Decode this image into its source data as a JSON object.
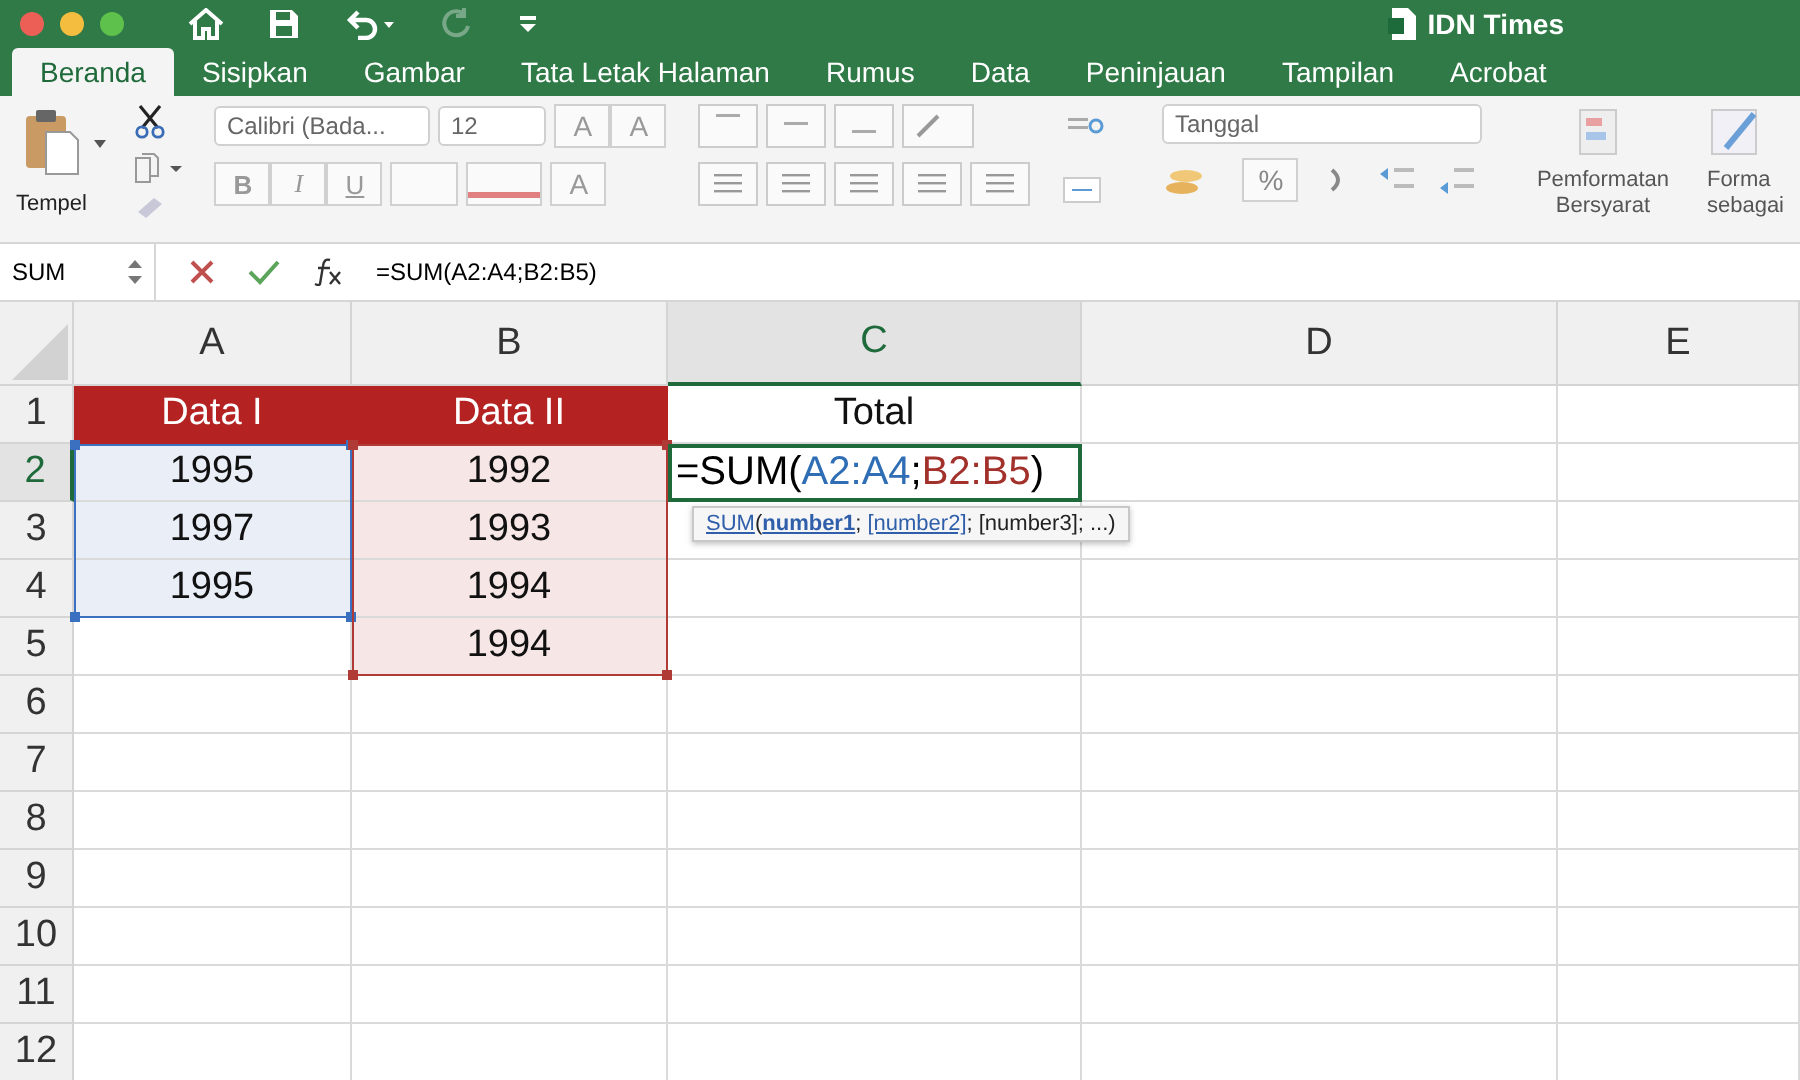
{
  "window": {
    "title": "IDN Times"
  },
  "quick_access": {
    "redo_disabled": true
  },
  "tabs": [
    {
      "label": "Beranda",
      "selected": true
    },
    {
      "label": "Sisipkan",
      "selected": false
    },
    {
      "label": "Gambar",
      "selected": false
    },
    {
      "label": "Tata Letak Halaman",
      "selected": false
    },
    {
      "label": "Rumus",
      "selected": false
    },
    {
      "label": "Data",
      "selected": false
    },
    {
      "label": "Peninjauan",
      "selected": false
    },
    {
      "label": "Tampilan",
      "selected": false
    },
    {
      "label": "Acrobat",
      "selected": false
    }
  ],
  "ribbon": {
    "paste_label": "Tempel",
    "font_name": "Calibri (Bada...",
    "font_size": "12",
    "grow_font": "A",
    "shrink_font": "A",
    "style_buttons": [
      "B",
      "I",
      "U"
    ],
    "font_color": "A",
    "number_format": "Tanggal",
    "percent": "%",
    "conditional_format": "Pemformatan Bersyarat",
    "format_table": [
      "Forma",
      "sebagai"
    ]
  },
  "formula_bar": {
    "name_box": "SUM",
    "formula": "=SUM(A2:A4;B2:B5)"
  },
  "sheet": {
    "columns": [
      {
        "label": "A",
        "selected": false
      },
      {
        "label": "B",
        "selected": false
      },
      {
        "label": "C",
        "selected": true
      },
      {
        "label": "D",
        "selected": false
      },
      {
        "label": "E",
        "selected": false
      }
    ],
    "rows": [
      {
        "label": "1",
        "selected": false,
        "cells": [
          {
            "kind": "header",
            "text": "Data I"
          },
          {
            "kind": "header",
            "text": "Data II"
          },
          {
            "kind": "plain",
            "text": "Total"
          },
          {
            "kind": "plain"
          },
          {
            "kind": "plain"
          }
        ]
      },
      {
        "label": "2",
        "selected": true,
        "cells": [
          {
            "kind": "range_a",
            "text": "1995"
          },
          {
            "kind": "range_b",
            "text": "1992"
          },
          {
            "kind": "editing"
          },
          {
            "kind": "plain"
          },
          {
            "kind": "plain"
          }
        ]
      },
      {
        "label": "3",
        "selected": false,
        "cells": [
          {
            "kind": "range_a",
            "text": "1997"
          },
          {
            "kind": "range_b",
            "text": "1993"
          },
          {
            "kind": "plain"
          },
          {
            "kind": "plain"
          },
          {
            "kind": "plain"
          }
        ]
      },
      {
        "label": "4",
        "selected": false,
        "cells": [
          {
            "kind": "range_a",
            "text": "1995"
          },
          {
            "kind": "range_b",
            "text": "1994"
          },
          {
            "kind": "plain"
          },
          {
            "kind": "plain"
          },
          {
            "kind": "plain"
          }
        ]
      },
      {
        "label": "5",
        "selected": false,
        "cells": [
          {
            "kind": "plain"
          },
          {
            "kind": "range_b",
            "text": "1994"
          },
          {
            "kind": "plain"
          },
          {
            "kind": "plain"
          },
          {
            "kind": "plain"
          }
        ]
      },
      {
        "label": "6",
        "selected": false,
        "cells": []
      },
      {
        "label": "7",
        "selected": false,
        "cells": []
      },
      {
        "label": "8",
        "selected": false,
        "cells": []
      },
      {
        "label": "9",
        "selected": false,
        "cells": []
      },
      {
        "label": "10",
        "selected": false,
        "cells": []
      },
      {
        "label": "11",
        "selected": false,
        "cells": []
      },
      {
        "label": "12",
        "selected": false,
        "cells": []
      }
    ],
    "edit_formula": [
      {
        "text": "=SUM(",
        "color": "#000000"
      },
      {
        "text": "A2:A4",
        "color": "#2f6db5"
      },
      {
        "text": ";",
        "color": "#000000"
      },
      {
        "text": "B2:B5",
        "color": "#a3312b"
      },
      {
        "text": ")",
        "color": "#000000"
      }
    ],
    "tooltip": [
      {
        "kind": "link",
        "text": "SUM"
      },
      {
        "kind": "plain",
        "text": "("
      },
      {
        "kind": "bold_link",
        "text": "number1"
      },
      {
        "kind": "plain",
        "text": "; "
      },
      {
        "kind": "link",
        "text": "[number2]"
      },
      {
        "kind": "plain",
        "text": "; [number3]; ...)"
      }
    ]
  }
}
